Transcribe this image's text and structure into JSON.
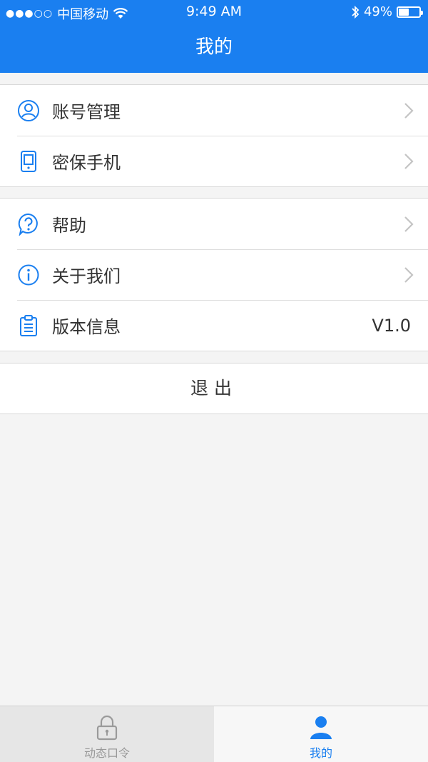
{
  "status_bar": {
    "carrier": "中国移动",
    "time": "9:49 AM",
    "battery": "49%",
    "battery_level": 0.49
  },
  "header": {
    "title": "我的"
  },
  "groups": [
    {
      "items": [
        {
          "label": "账号管理",
          "icon": "account-icon",
          "accessory": "chevron"
        },
        {
          "label": "密保手机",
          "icon": "phone-icon",
          "accessory": "chevron"
        }
      ]
    },
    {
      "items": [
        {
          "label": "帮助",
          "icon": "help-icon",
          "accessory": "chevron"
        },
        {
          "label": "关于我们",
          "icon": "info-icon",
          "accessory": "chevron"
        },
        {
          "label": "版本信息",
          "icon": "clipboard-icon",
          "value": "V1.0"
        }
      ]
    }
  ],
  "logout_label": "退出",
  "tabbar": {
    "tabs": [
      {
        "label": "动态口令",
        "icon": "lock-icon",
        "active": false
      },
      {
        "label": "我的",
        "icon": "user-icon",
        "active": true
      }
    ]
  },
  "colors": {
    "primary": "#1a7ff0",
    "background": "#f4f4f4",
    "text": "#333333"
  }
}
